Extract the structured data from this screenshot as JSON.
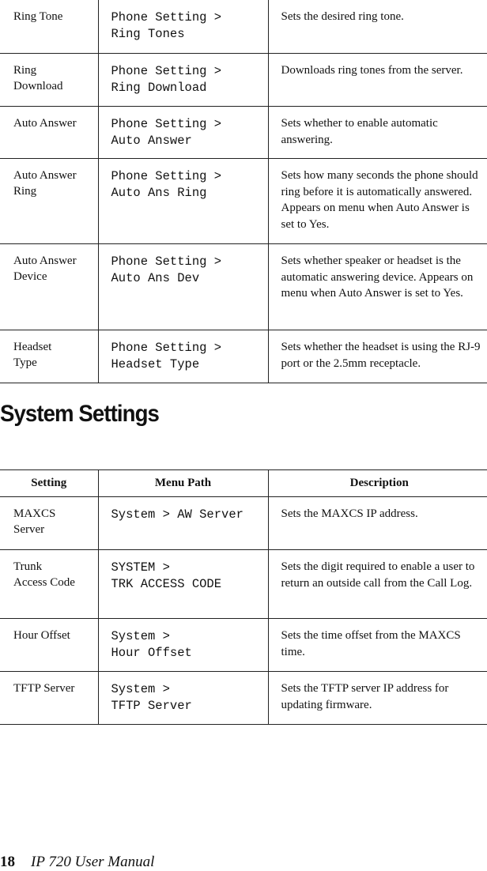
{
  "phone_settings_table": {
    "rows": [
      {
        "setting": "Ring Tone",
        "menu_path": "Phone Setting >\nRing Tones",
        "description": "Sets the desired ring tone."
      },
      {
        "setting": "Ring\nDownload",
        "menu_path": "Phone Setting >\nRing Download",
        "description": "Downloads ring tones from the server."
      },
      {
        "setting": "Auto Answer",
        "menu_path": "Phone Setting >\nAuto Answer",
        "description": "Sets whether to enable automatic answering."
      },
      {
        "setting": "Auto Answer Ring",
        "menu_path": "Phone Setting >\nAuto Ans Ring",
        "description": "Sets how many seconds the phone should ring before it is automatically answered. Appears on menu when Auto Answer is set to Yes."
      },
      {
        "setting": "Auto Answer Device",
        "menu_path": "Phone Setting >\nAuto Ans Dev",
        "description": "Sets whether speaker or headset is the automatic answering device. Appears on menu when Auto Answer is set to Yes."
      },
      {
        "setting": "Headset\nType",
        "menu_path": "Phone Setting >\nHeadset Type",
        "description": "Sets whether the headset is using the RJ-9 port or the 2.5mm receptacle."
      }
    ]
  },
  "system_settings": {
    "heading": "System Settings",
    "headers": {
      "setting": "Setting",
      "menu_path": "Menu Path",
      "description": "Description"
    },
    "rows": [
      {
        "setting": "MAXCS\nServer",
        "menu_path": "System > AW Server",
        "description": "Sets the MAXCS IP address."
      },
      {
        "setting": "Trunk\nAccess Code",
        "menu_path": "SYSTEM >\nTRK ACCESS CODE",
        "description": "Sets the digit required to enable a user to return an outside call from the Call Log."
      },
      {
        "setting": "Hour Offset",
        "menu_path": "System >\nHour Offset",
        "description": "Sets the time offset from the MAXCS time."
      },
      {
        "setting": "TFTP Server",
        "menu_path": "System >\nTFTP Server",
        "description": "Sets the TFTP server IP address for updating firmware."
      }
    ]
  },
  "footer": {
    "page_number": "18",
    "manual_title": "IP 720 User Manual"
  }
}
